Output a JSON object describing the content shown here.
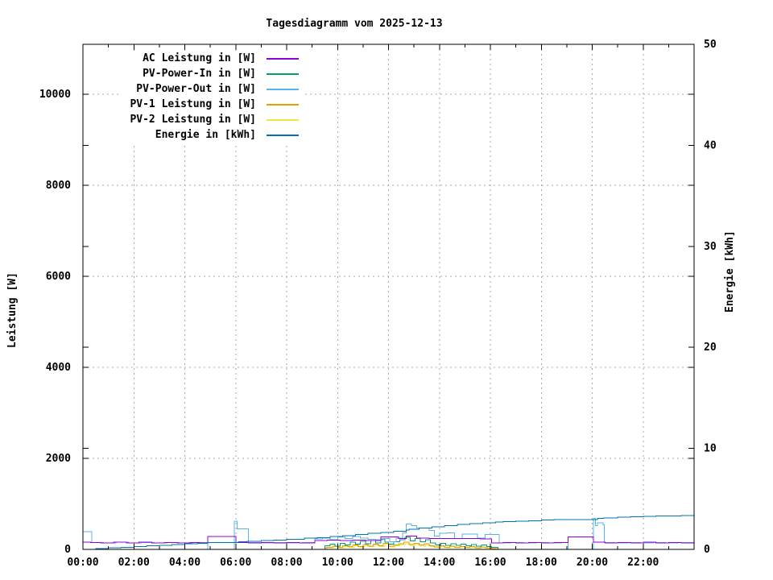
{
  "title": "Tagesdiagramm vom 2025-12-13",
  "axes": {
    "y_left": {
      "label": "Leistung [W]",
      "tick_labels": [
        "0",
        "2000",
        "4000",
        "6000",
        "8000",
        "10000"
      ],
      "ticks": [
        0,
        2000,
        4000,
        6000,
        8000,
        10000
      ],
      "min": 0,
      "max": 11100
    },
    "y_right": {
      "label": "Energie [kWh]",
      "tick_labels": [
        "0",
        "10",
        "20",
        "30",
        "40",
        "50"
      ],
      "ticks": [
        0,
        10,
        20,
        30,
        40,
        50
      ],
      "min": 0,
      "max": 50
    },
    "x": {
      "tick_labels": [
        "00:00",
        "02:00",
        "04:00",
        "06:00",
        "08:00",
        "10:00",
        "12:00",
        "14:00",
        "16:00",
        "18:00",
        "20:00",
        "22:00"
      ],
      "tick_hours": [
        0,
        2,
        4,
        6,
        8,
        10,
        12,
        14,
        16,
        18,
        20,
        22
      ],
      "minor_every_hours": 1,
      "min": 0,
      "max": 24
    }
  },
  "chart_data": {
    "type": "line",
    "title": "Tagesdiagramm vom 2025-12-13",
    "xlabel": "",
    "ylabel_left": "Leistung [W]",
    "ylabel_right": "Energie [kWh]",
    "xlim_hours": [
      0,
      24
    ],
    "ylim_left": [
      0,
      11100
    ],
    "ylim_right": [
      0,
      50
    ],
    "grid": true,
    "legend_position": "top-left",
    "line_style": "steps",
    "series": [
      {
        "name": "PV-2 Leistung in [W]",
        "axis": "left",
        "color": "#f0e442",
        "legend_order": 4,
        "points": [
          [
            0,
            0
          ],
          [
            9.45,
            0
          ],
          [
            9.6,
            34
          ],
          [
            9.85,
            56
          ],
          [
            10.05,
            36
          ],
          [
            10.25,
            66
          ],
          [
            10.45,
            44
          ],
          [
            10.65,
            78
          ],
          [
            10.85,
            50
          ],
          [
            11.05,
            88
          ],
          [
            11.25,
            58
          ],
          [
            11.45,
            98
          ],
          [
            11.65,
            66
          ],
          [
            11.85,
            110
          ],
          [
            12.05,
            54
          ],
          [
            12.25,
            82
          ],
          [
            12.45,
            105
          ],
          [
            12.65,
            128
          ],
          [
            12.85,
            86
          ],
          [
            13.05,
            110
          ],
          [
            13.25,
            75
          ],
          [
            13.45,
            98
          ],
          [
            13.65,
            60
          ],
          [
            13.85,
            40
          ],
          [
            14.05,
            64
          ],
          [
            14.25,
            37
          ],
          [
            14.45,
            58
          ],
          [
            14.65,
            34
          ],
          [
            14.85,
            52
          ],
          [
            15.05,
            31
          ],
          [
            15.25,
            48
          ],
          [
            15.45,
            28
          ],
          [
            15.65,
            44
          ],
          [
            15.85,
            25
          ],
          [
            16.05,
            16
          ],
          [
            16.2,
            0
          ],
          [
            24,
            0
          ]
        ]
      },
      {
        "name": "PV-1 Leistung in [W]",
        "axis": "left",
        "color": "#e69f00",
        "legend_order": 3,
        "points": [
          [
            0,
            0
          ],
          [
            9.4,
            0
          ],
          [
            9.55,
            40
          ],
          [
            9.8,
            70
          ],
          [
            10,
            48
          ],
          [
            10.2,
            80
          ],
          [
            10.4,
            58
          ],
          [
            10.6,
            95
          ],
          [
            10.8,
            62
          ],
          [
            11,
            105
          ],
          [
            11.2,
            72
          ],
          [
            11.4,
            118
          ],
          [
            11.6,
            82
          ],
          [
            11.8,
            132
          ],
          [
            12,
            68
          ],
          [
            12.2,
            100
          ],
          [
            12.4,
            128
          ],
          [
            12.6,
            155
          ],
          [
            12.8,
            105
          ],
          [
            13,
            132
          ],
          [
            13.2,
            95
          ],
          [
            13.4,
            120
          ],
          [
            13.6,
            78
          ],
          [
            13.8,
            50
          ],
          [
            14,
            78
          ],
          [
            14.2,
            48
          ],
          [
            14.4,
            72
          ],
          [
            14.6,
            45
          ],
          [
            14.8,
            66
          ],
          [
            15,
            42
          ],
          [
            15.2,
            60
          ],
          [
            15.4,
            38
          ],
          [
            15.6,
            55
          ],
          [
            15.8,
            33
          ],
          [
            16.05,
            22
          ],
          [
            16.25,
            0
          ],
          [
            24,
            0
          ]
        ]
      },
      {
        "name": "PV-Power-In in [W]",
        "axis": "left",
        "color": "#009e73",
        "legend_order": 1,
        "points": [
          [
            0,
            0
          ],
          [
            9.35,
            0
          ],
          [
            9.5,
            80
          ],
          [
            9.7,
            115
          ],
          [
            9.9,
            75
          ],
          [
            10.1,
            135
          ],
          [
            10.3,
            95
          ],
          [
            10.5,
            160
          ],
          [
            10.7,
            115
          ],
          [
            10.9,
            175
          ],
          [
            11.1,
            125
          ],
          [
            11.3,
            195
          ],
          [
            11.5,
            140
          ],
          [
            11.7,
            230
          ],
          [
            11.85,
            160
          ],
          [
            12,
            115
          ],
          [
            12.2,
            170
          ],
          [
            12.45,
            210
          ],
          [
            12.65,
            265
          ],
          [
            12.85,
            190
          ],
          [
            13.05,
            235
          ],
          [
            13.25,
            165
          ],
          [
            13.45,
            210
          ],
          [
            13.65,
            145
          ],
          [
            13.85,
            95
          ],
          [
            14.05,
            135
          ],
          [
            14.25,
            90
          ],
          [
            14.45,
            125
          ],
          [
            14.65,
            85
          ],
          [
            14.85,
            115
          ],
          [
            15.05,
            80
          ],
          [
            15.25,
            105
          ],
          [
            15.45,
            70
          ],
          [
            15.65,
            100
          ],
          [
            15.85,
            65
          ],
          [
            16.05,
            45
          ],
          [
            16.3,
            0
          ],
          [
            24,
            0
          ]
        ]
      },
      {
        "name": "PV-Power-Out in [W]",
        "axis": "left",
        "color": "#56b4e9",
        "legend_order": 2,
        "points": [
          [
            0,
            390
          ],
          [
            0.35,
            150
          ],
          [
            0.8,
            142
          ],
          [
            1.3,
            156
          ],
          [
            1.8,
            144
          ],
          [
            2.3,
            154
          ],
          [
            2.8,
            145
          ],
          [
            3.3,
            153
          ],
          [
            3.8,
            146
          ],
          [
            4.3,
            152
          ],
          [
            4.9,
            0
          ],
          [
            5.95,
            620
          ],
          [
            6.05,
            455
          ],
          [
            6.45,
            455
          ],
          [
            6.5,
            150
          ],
          [
            7,
            145
          ],
          [
            7.5,
            154
          ],
          [
            8,
            146
          ],
          [
            8.6,
            153
          ],
          [
            9.1,
            230
          ],
          [
            9.4,
            250
          ],
          [
            9.7,
            210
          ],
          [
            10,
            270
          ],
          [
            10.3,
            235
          ],
          [
            10.6,
            280
          ],
          [
            10.9,
            250
          ],
          [
            11.2,
            225
          ],
          [
            11.5,
            215
          ],
          [
            11.8,
            235
          ],
          [
            12.05,
            170
          ],
          [
            12.3,
            250
          ],
          [
            12.55,
            360
          ],
          [
            12.7,
            560
          ],
          [
            12.9,
            520
          ],
          [
            13.1,
            465
          ],
          [
            13.35,
            470
          ],
          [
            13.6,
            420
          ],
          [
            13.8,
            290
          ],
          [
            14,
            350
          ],
          [
            14.3,
            360
          ],
          [
            14.6,
            240
          ],
          [
            14.9,
            340
          ],
          [
            15.2,
            335
          ],
          [
            15.5,
            245
          ],
          [
            15.8,
            325
          ],
          [
            16.1,
            330
          ],
          [
            16.35,
            145
          ],
          [
            16.8,
            154
          ],
          [
            17.3,
            145
          ],
          [
            17.8,
            152
          ],
          [
            18.3,
            146
          ],
          [
            18.8,
            152
          ],
          [
            19.05,
            0
          ],
          [
            20.05,
            680
          ],
          [
            20.12,
            520
          ],
          [
            20.2,
            580
          ],
          [
            20.42,
            540
          ],
          [
            20.47,
            150
          ],
          [
            20.9,
            144
          ],
          [
            21.4,
            154
          ],
          [
            21.9,
            146
          ],
          [
            22.4,
            152
          ],
          [
            22.9,
            145
          ],
          [
            23.4,
            152
          ],
          [
            23.9,
            147
          ],
          [
            24,
            150
          ]
        ]
      },
      {
        "name": "AC Leistung in [W]",
        "axis": "left",
        "color": "#9400d3",
        "legend_order": 0,
        "points": [
          [
            0,
            160
          ],
          [
            0.3,
            150
          ],
          [
            0.7,
            140
          ],
          [
            1.2,
            158
          ],
          [
            1.7,
            143
          ],
          [
            2.2,
            156
          ],
          [
            2.7,
            144
          ],
          [
            3.2,
            154
          ],
          [
            3.7,
            142
          ],
          [
            4.2,
            152
          ],
          [
            4.6,
            145
          ],
          [
            4.9,
            285
          ],
          [
            5.95,
            285
          ],
          [
            6,
            152
          ],
          [
            6.5,
            142
          ],
          [
            7,
            154
          ],
          [
            7.5,
            144
          ],
          [
            8,
            152
          ],
          [
            8.5,
            145
          ],
          [
            9.1,
            195
          ],
          [
            9.6,
            205
          ],
          [
            10.1,
            196
          ],
          [
            10.6,
            206
          ],
          [
            11.1,
            198
          ],
          [
            11.7,
            275
          ],
          [
            12.4,
            240
          ],
          [
            12.7,
            290
          ],
          [
            13.1,
            245
          ],
          [
            13.6,
            238
          ],
          [
            14.1,
            242
          ],
          [
            14.6,
            236
          ],
          [
            15.1,
            240
          ],
          [
            15.6,
            234
          ],
          [
            16.05,
            140
          ],
          [
            16.5,
            150
          ],
          [
            17,
            142
          ],
          [
            17.5,
            152
          ],
          [
            18,
            144
          ],
          [
            18.5,
            150
          ],
          [
            19.05,
            272
          ],
          [
            20.05,
            160
          ],
          [
            20.5,
            146
          ],
          [
            21,
            154
          ],
          [
            21.5,
            144
          ],
          [
            22,
            155
          ],
          [
            22.5,
            145
          ],
          [
            23,
            152
          ],
          [
            23.5,
            146
          ],
          [
            24,
            152
          ]
        ]
      },
      {
        "name": "Energie in [kWh]",
        "axis": "right",
        "color": "#0072b2",
        "legend_order": 5,
        "points": [
          [
            0,
            0
          ],
          [
            0.5,
            0.07
          ],
          [
            1,
            0.14
          ],
          [
            1.5,
            0.2
          ],
          [
            2,
            0.27
          ],
          [
            2.5,
            0.34
          ],
          [
            3,
            0.4
          ],
          [
            3.5,
            0.47
          ],
          [
            4,
            0.54
          ],
          [
            4.5,
            0.6
          ],
          [
            4.9,
            0.66
          ],
          [
            5.95,
            0.66
          ],
          [
            6.1,
            0.74
          ],
          [
            6.45,
            0.8
          ],
          [
            7,
            0.87
          ],
          [
            7.5,
            0.93
          ],
          [
            8,
            1.0
          ],
          [
            8.7,
            1.1
          ],
          [
            9.2,
            1.17
          ],
          [
            9.7,
            1.26
          ],
          [
            10.2,
            1.37
          ],
          [
            10.7,
            1.48
          ],
          [
            11.2,
            1.58
          ],
          [
            11.7,
            1.69
          ],
          [
            12.2,
            1.8
          ],
          [
            12.7,
            1.91
          ],
          [
            12.8,
            1.98
          ],
          [
            13.2,
            2.12
          ],
          [
            13.7,
            2.25
          ],
          [
            14.2,
            2.36
          ],
          [
            14.7,
            2.46
          ],
          [
            15.2,
            2.55
          ],
          [
            15.7,
            2.64
          ],
          [
            16.2,
            2.72
          ],
          [
            16.5,
            2.76
          ],
          [
            17,
            2.81
          ],
          [
            17.5,
            2.85
          ],
          [
            18,
            2.9
          ],
          [
            18.5,
            2.94
          ],
          [
            19,
            2.97
          ],
          [
            20.05,
            2.97
          ],
          [
            20.2,
            3.06
          ],
          [
            20.45,
            3.11
          ],
          [
            21,
            3.17
          ],
          [
            21.5,
            3.21
          ],
          [
            22,
            3.26
          ],
          [
            22.5,
            3.29
          ],
          [
            23,
            3.32
          ],
          [
            23.5,
            3.35
          ],
          [
            24,
            3.38
          ]
        ]
      }
    ]
  },
  "legend_labels": {
    "row0": "AC Leistung in [W]",
    "row1": "PV-Power-In in [W]",
    "row2": "PV-Power-Out in [W]",
    "row3": "PV-1 Leistung in [W]",
    "row4": "PV-2 Leistung in [W]",
    "row5": "Energie in [kWh]"
  },
  "colors": {
    "ac": "#9400d3",
    "pv_in": "#009e73",
    "pv_out": "#56b4e9",
    "pv1": "#e69f00",
    "pv2": "#f0e442",
    "energie": "#0072b2",
    "grid": "#a8a8a8",
    "border": "#000000",
    "background": "#ffffff"
  }
}
